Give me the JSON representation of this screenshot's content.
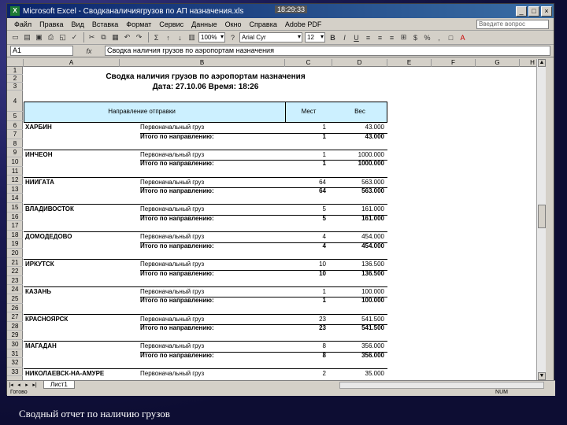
{
  "window": {
    "title": "Microsoft Excel - Сводканаличиягрузов по АП назначения.xls",
    "clock": "18:29:33",
    "minimize": "_",
    "maximize": "□",
    "close": "×"
  },
  "menu": {
    "items": [
      "Файл",
      "Правка",
      "Вид",
      "Вставка",
      "Формат",
      "Сервис",
      "Данные",
      "Окно",
      "Справка",
      "Adobe PDF"
    ],
    "help_placeholder": "Введите вопрос"
  },
  "toolbar": {
    "zoom": "100%",
    "font": "Arial Cyr",
    "font_size": "12"
  },
  "formula_bar": {
    "name_box": "A1",
    "fx": "fx",
    "content": "Сводка наличия грузов по аэропортам назначения"
  },
  "columns": [
    "A",
    "B",
    "C",
    "D",
    "E",
    "F",
    "G",
    "H"
  ],
  "rows": [
    "1",
    "2",
    "3",
    "4",
    "5",
    "6",
    "7",
    "8",
    "9",
    "10",
    "11",
    "12",
    "13",
    "14",
    "15",
    "16",
    "17",
    "18",
    "19",
    "20",
    "21",
    "22",
    "23",
    "24",
    "25",
    "26",
    "27",
    "28",
    "29",
    "30",
    "31",
    "32",
    "33"
  ],
  "sheet": {
    "title": "Сводка наличия грузов по аэропортам назначения",
    "date_line": "Дата: 27.10.06 Время: 18:26",
    "headers": {
      "direction": "Направление отправки",
      "places": "Мест",
      "weight": "Вес"
    },
    "entries": [
      {
        "city": "ХАРБИН",
        "type": "Первоначальный груз",
        "places": "1",
        "weight": "43.000",
        "total_label": "Итого по направлению:",
        "total_places": "1",
        "total_weight": "43.000"
      },
      {
        "city": "ИНЧЕОН",
        "type": "Первоначальный груз",
        "places": "1",
        "weight": "1000.000",
        "total_label": "Итого по направлению:",
        "total_places": "1",
        "total_weight": "1000.000"
      },
      {
        "city": "НИИГАТА",
        "type": "Первоначальный груз",
        "places": "64",
        "weight": "563.000",
        "total_label": "Итого по направлению:",
        "total_places": "64",
        "total_weight": "563.000"
      },
      {
        "city": "ВЛАДИВОСТОК",
        "type": "Первоначальный груз",
        "places": "5",
        "weight": "161.000",
        "total_label": "Итого по направлению:",
        "total_places": "5",
        "total_weight": "161.000"
      },
      {
        "city": "ДОМОДЕДОВО",
        "type": "Первоначальный груз",
        "places": "4",
        "weight": "454.000",
        "total_label": "Итого по направлению:",
        "total_places": "4",
        "total_weight": "454.000"
      },
      {
        "city": "ИРКУТСК",
        "type": "Первоначальный груз",
        "places": "10",
        "weight": "136.500",
        "total_label": "Итого по направлению:",
        "total_places": "10",
        "total_weight": "136.500"
      },
      {
        "city": "КАЗАНЬ",
        "type": "Первоначальный груз",
        "places": "1",
        "weight": "100.000",
        "total_label": "Итого по направлению:",
        "total_places": "1",
        "total_weight": "100.000"
      },
      {
        "city": "КРАСНОЯРСК",
        "type": "Первоначальный груз",
        "places": "23",
        "weight": "541.500",
        "total_label": "Итого по направлению:",
        "total_places": "23",
        "total_weight": "541.500"
      },
      {
        "city": "МАГАДАН",
        "type": "Первоначальный груз",
        "places": "8",
        "weight": "356.000",
        "total_label": "Итого по направлению:",
        "total_places": "8",
        "total_weight": "356.000"
      },
      {
        "city": "НИКОЛАЕВСК-НА-АМУРЕ",
        "type": "Первоначальный груз",
        "places": "2",
        "weight": "35.000"
      }
    ]
  },
  "tabs": [
    "Лист1"
  ],
  "status": {
    "left": "Готово",
    "right": "NUM"
  },
  "caption": "Сводный отчет по наличию грузов"
}
